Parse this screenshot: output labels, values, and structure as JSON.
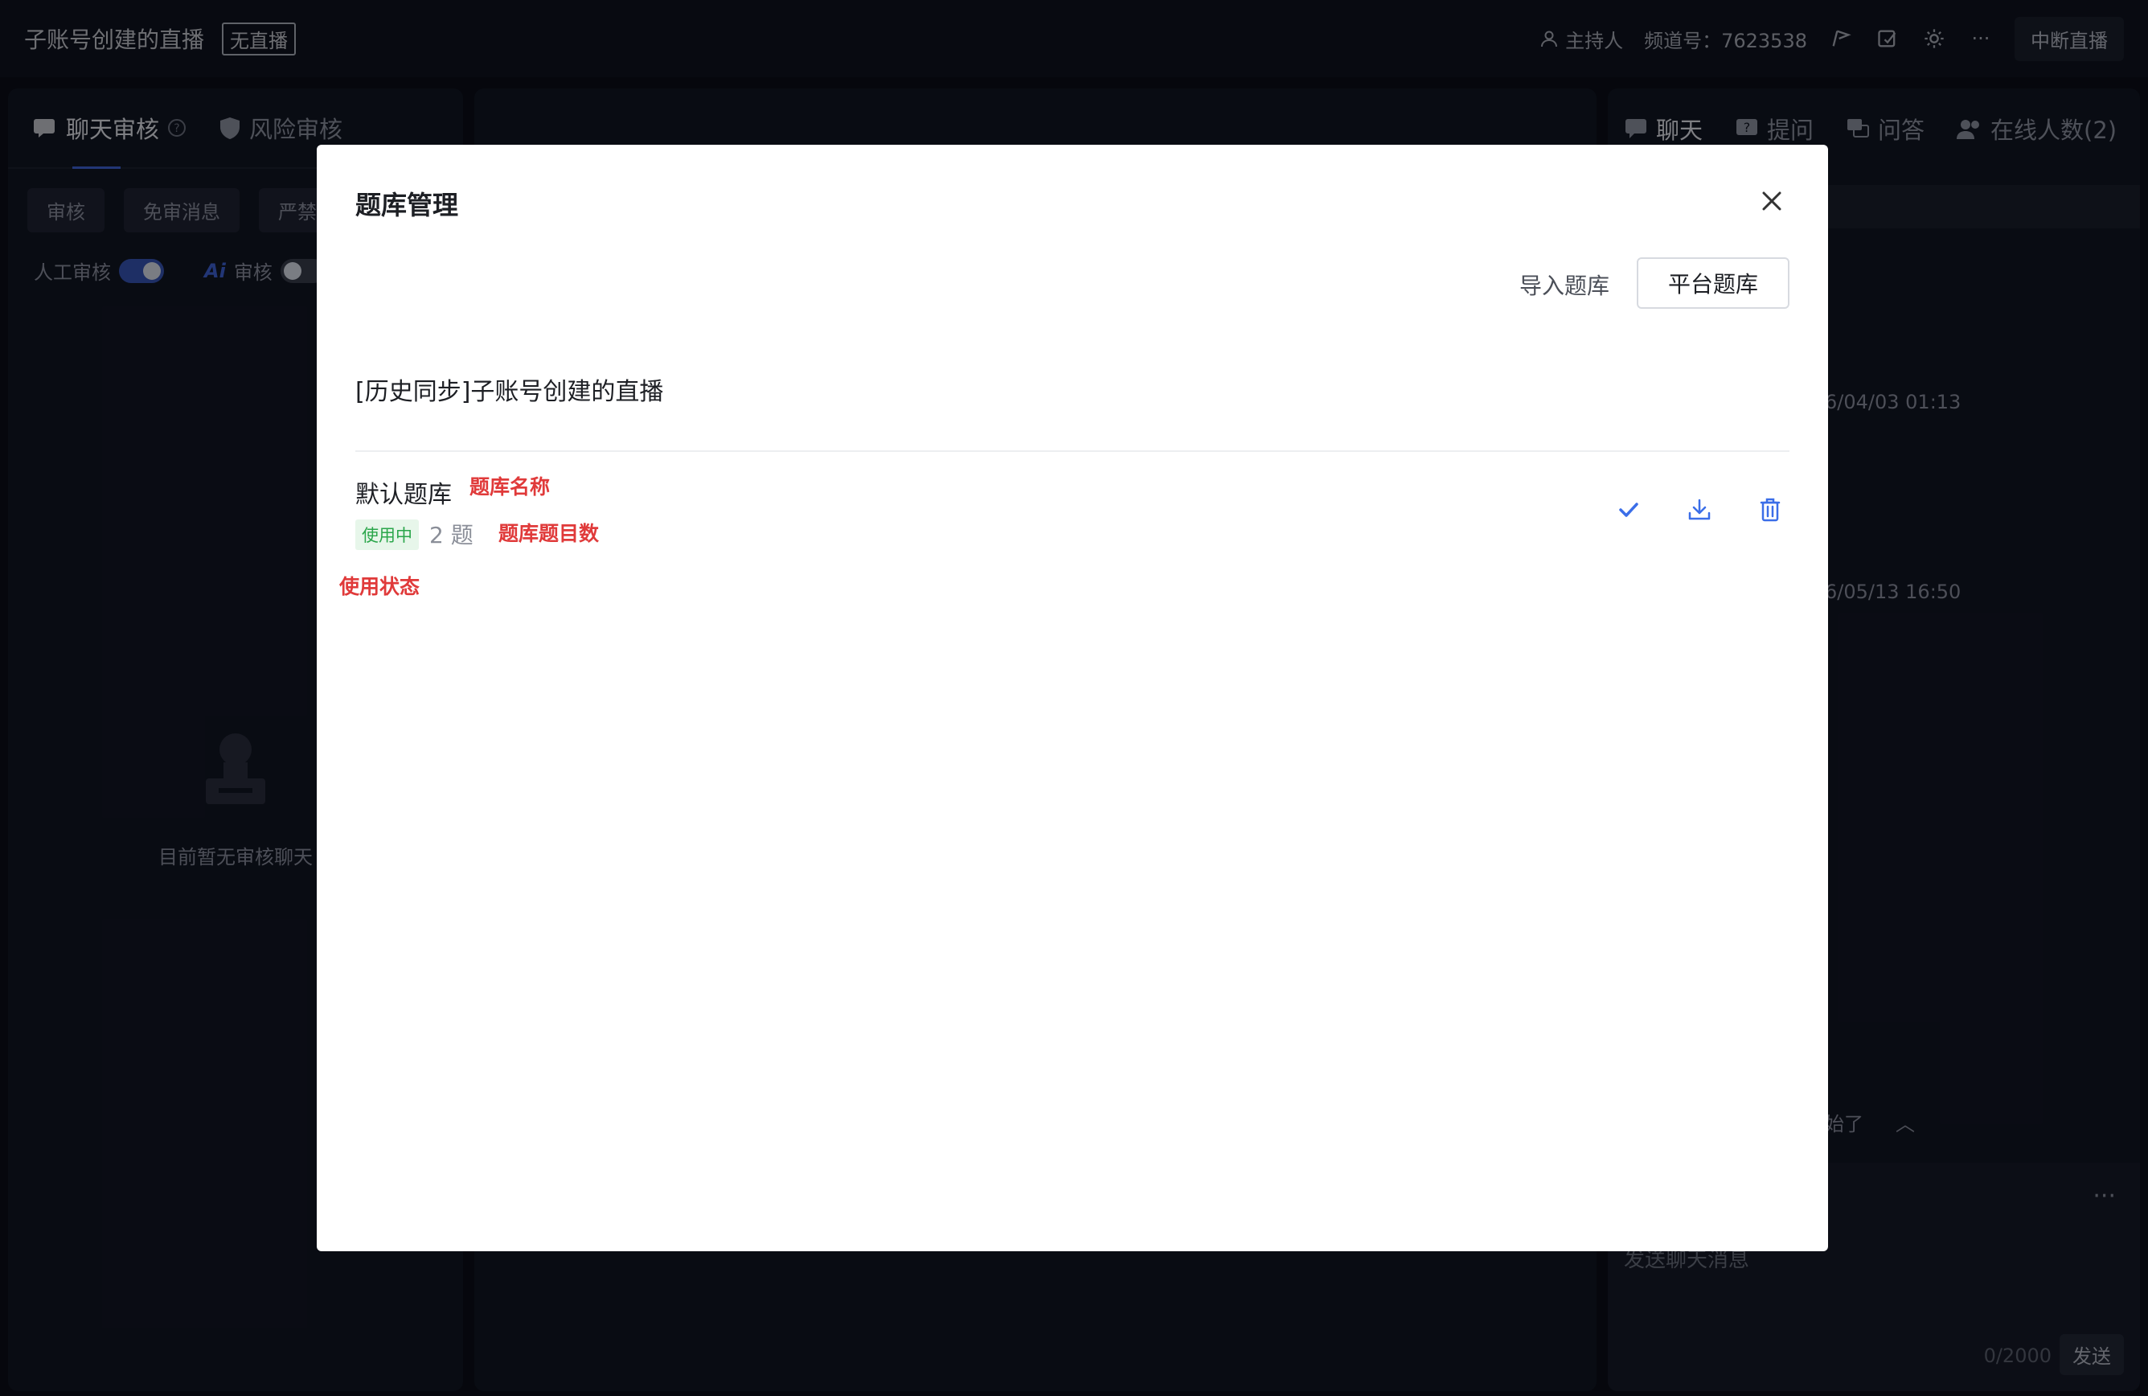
{
  "topbar": {
    "title": "子账号创建的直播",
    "badge": "无直播",
    "host_label": "主持人",
    "channel_label": "频道号：7623538",
    "more": "···",
    "stop_button": "中断直播"
  },
  "left_panel": {
    "tabs": [
      {
        "label": "聊天审核",
        "icon": "chat-review-icon"
      },
      {
        "label": "风险审核",
        "icon": "shield-icon"
      }
    ],
    "chips": [
      "审核",
      "免审消息",
      "严禁"
    ],
    "toggles": [
      {
        "label": "人工审核",
        "on": true
      },
      {
        "label": "审核",
        "prefix": "Ai",
        "on": false
      }
    ],
    "empty_text": "目前暂无审核聊天"
  },
  "right_panel": {
    "tabs": [
      {
        "label": "聊天",
        "icon": "chat-icon"
      },
      {
        "label": "提问",
        "icon": "question-icon"
      },
      {
        "label": "问答",
        "icon": "qa-icon"
      },
      {
        "label": "在线人数(2)",
        "icon": "users-icon"
      }
    ],
    "timestamps": [
      "6/04/03 01:13",
      "6/05/13 16:50"
    ],
    "bottom_text": "始了",
    "input_more": "···",
    "input_placeholder": "发送聊天消息",
    "char_count": "0/2000",
    "send_button": "发送"
  },
  "modal": {
    "title": "题库管理",
    "import_link": "导入题库",
    "platform_button": "平台题库",
    "section_title": "[历史同步]子账号创建的直播",
    "bank": {
      "name": "默认题库",
      "status": "使用中",
      "count": "2 题"
    },
    "annotations": {
      "name": "题库名称",
      "count": "题库题目数",
      "status": "使用状态"
    },
    "colors": {
      "accent": "#3b6ee8",
      "annotation": "#e03a3a",
      "status": "#2aa64a"
    }
  }
}
